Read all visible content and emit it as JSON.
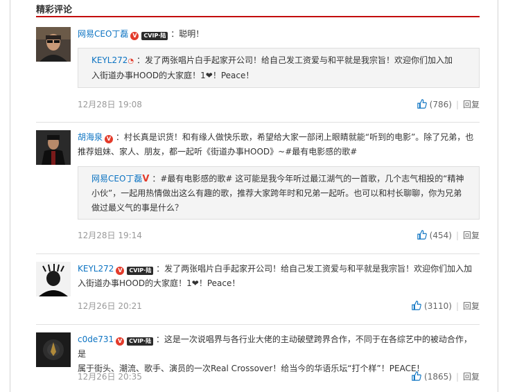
{
  "section": {
    "title": "精彩评论"
  },
  "comments": [
    {
      "user": "网易CEO丁磊",
      "badges": {
        "v": "V",
        "vip": "CVIP·陆"
      },
      "text": "：聪明！",
      "reply": {
        "user": "KEYL272",
        "text": "：发了两张唱片白手起家开公司！给自己发工资爱与和平就是我宗旨！欢迎你们加入加",
        "text2": "入街道办事HOOD的大家庭！1❤！Peace！"
      },
      "time": "12月28日 19:08",
      "likes": "(786)",
      "reply_label": "回复"
    },
    {
      "user": "胡海泉",
      "badges": {
        "v": "V"
      },
      "text": "：村长真是识货！和有缘人做快乐歌，希望给大家一部闭上眼睛就能“听到的电影”。除了兄弟，也",
      "text2": "推荐姐妹、家人、朋友，都一起听《街道办事HOOD》~#最有电影感的歌#",
      "reply": {
        "user": "网易CEO丁磊",
        "v": "V",
        "text": "：#最有电影感的歌# 这可能是我今年听过最江湖气的一首歌，几个志气相投的“精神",
        "text2": "小伙”，一起用热情做出这么有趣的歌，推荐大家跨年时和兄弟一起听。也可以和村长聊聊，你为兄弟",
        "text3": "做过最义气的事是什么？"
      },
      "time": "12月28日 19:14",
      "likes": "(454)",
      "reply_label": "回复"
    },
    {
      "user": "KEYL272",
      "badges": {
        "v": "V",
        "vip": "CVIP·陆"
      },
      "text": "：发了两张唱片白手起家开公司！给自己发工资爱与和平就是我宗旨！欢迎你们加入加",
      "text2": "入街道办事HOOD的大家庭！1❤！Peace！",
      "time": "12月26日 20:21",
      "likes": "(3110)",
      "reply_label": "回复"
    },
    {
      "user": "c0de731",
      "badges": {
        "v": "V",
        "vip": "CVIP·陆"
      },
      "text": "：这是一次说唱界与各行业大佬的主动破壁跨界合作，不同于在各综艺中的被动合作，是",
      "text2": "属于街头、潮流、歌手、演员的一次Real Crossover！给当今的华语乐坛“打个样”！PEACE！",
      "time": "12月26日 20:35",
      "likes": "(1865)",
      "reply_label": "回复"
    }
  ],
  "colors": {
    "link": "#0c73c2",
    "accent": "#c20c0c",
    "muted": "#999999"
  },
  "icons": {
    "like": "thumbs-up-icon"
  }
}
